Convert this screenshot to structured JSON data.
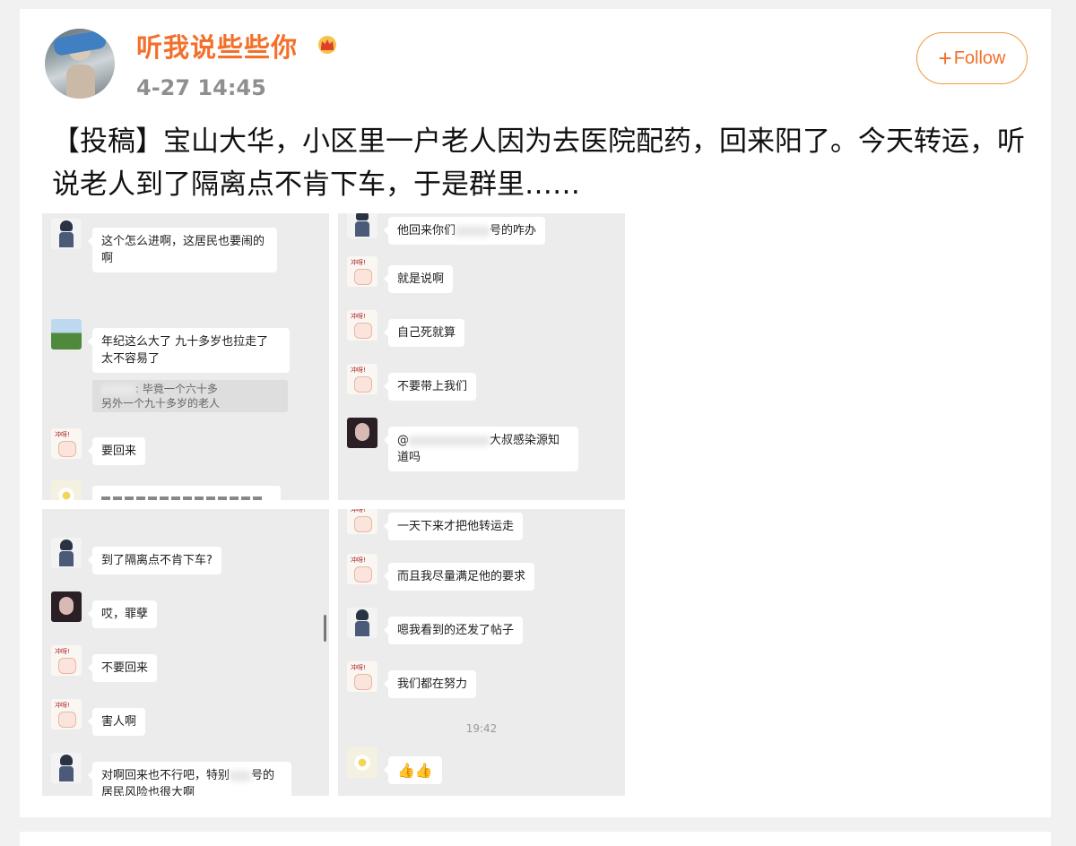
{
  "post": {
    "username": "听我说些些你",
    "timestamp": "4-27 14:45",
    "follow_label": "Follow",
    "text": "【投稿】宝山大华，小区里一户老人因为去医院配药，回来阳了。今天转运，听说老人到了隔离点不肯下车，于是群里……"
  },
  "screenshots": {
    "p1": {
      "m1": "这个怎么进啊，这居民也要闹的啊",
      "m2": "年纪这么大了 九十多岁也拉走了 太不容易了",
      "quote_a": ": 毕竟一个六十多",
      "quote_b": "另外一个九十多岁的老人",
      "m3": "要回来"
    },
    "p2": {
      "m1a": "他回来你们",
      "m1b": "号的咋办",
      "m2": "就是说啊",
      "m3": "自己死就算",
      "m4": "不要带上我们",
      "m5a": "@",
      "m5b": "大叔感染源知道吗"
    },
    "p3": {
      "m1": "到了隔离点不肯下车?",
      "m2": "哎，罪孽",
      "m3": "不要回来",
      "m4": "害人啊",
      "m5a": "对啊回来也不行吧，特别",
      "m5b": "号的居民风险也很大啊"
    },
    "p4": {
      "m1": "一天下来才把他转运走",
      "m2": "而且我尽量满足他的要求",
      "m3": "嗯我看到的还发了帖子",
      "m4": "我们都在努力",
      "time": "19:42",
      "m5": "👍👍"
    }
  }
}
